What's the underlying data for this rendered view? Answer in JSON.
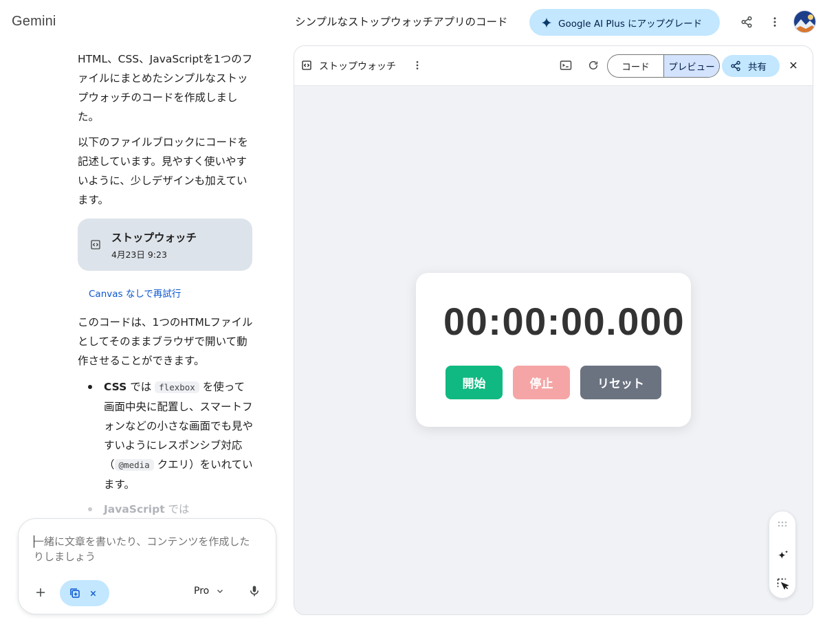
{
  "header": {
    "brand": "Gemini",
    "doc_title": "シンプルなストップウォッチアプリのコード",
    "upgrade_label": "Google AI Plus にアップグレード"
  },
  "chat": {
    "intro": "HTML、CSS、JavaScriptを1つのファイルにまとめたシンプルなストップウォッチのコードを作成しました。",
    "para2": "以下のファイルブロックにコードを記述しています。見やすく使いやすいように、少しデザインも加えています。",
    "file_card": {
      "title": "ストップウォッチ",
      "date": "4月23日 9:23"
    },
    "retry_link": "Canvas なしで再試行",
    "para3": "このコードは、1つのHTMLファイルとしてそのままブラウザで開いて動作させることができます。",
    "bullet1": {
      "strong": "CSS",
      "text1": " では ",
      "code1": "flexbox",
      "text2": " を使って画面中央に配置し、スマートフォンなどの小さな画面でも見やすいようにレスポンシブ対応（",
      "code2": "@media",
      "text3": " クエリ）をいれています。"
    },
    "bullet2": {
      "strong": "JavaScript",
      "text": " では"
    }
  },
  "composer": {
    "placeholder": "一緒に文章を書いたり、コンテンツを作成したりしましょう",
    "model": "Pro"
  },
  "panel": {
    "title": "ストップウォッチ",
    "tab_code": "コード",
    "tab_preview": "プレビュー",
    "share_label": "共有",
    "active_tab": "プレビュー"
  },
  "stopwatch": {
    "time": "00:00:00.000",
    "start_label": "開始",
    "stop_label": "停止",
    "reset_label": "リセット"
  },
  "colors": {
    "accent_blue": "#c2e7ff",
    "start_green": "#10b981",
    "stop_pink": "#f5a5a5",
    "reset_gray": "#6b7280",
    "link_blue": "#0b57d0"
  }
}
